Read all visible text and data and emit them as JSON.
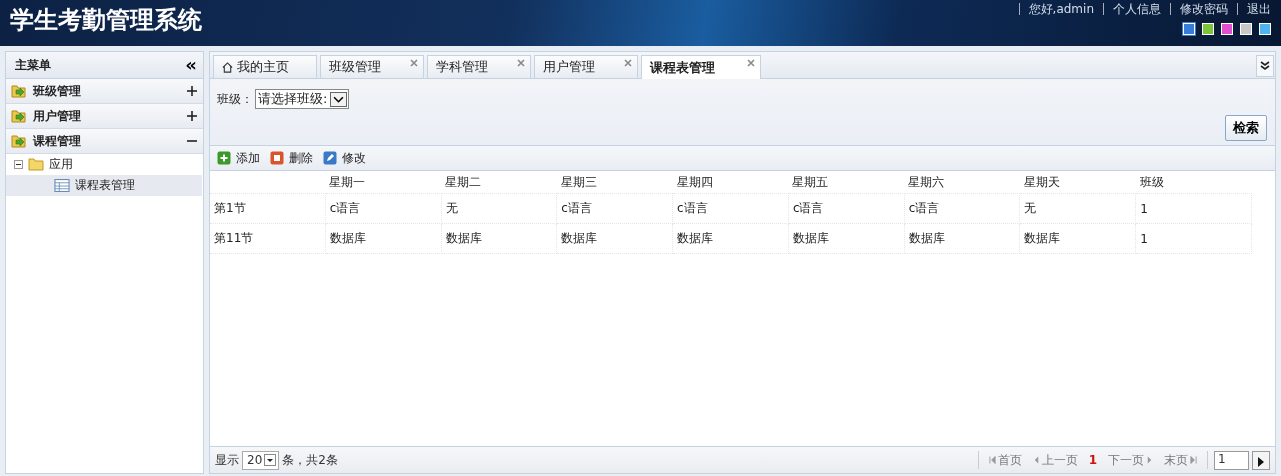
{
  "header": {
    "title": "学生考勤管理系统",
    "links": [
      "您好,admin",
      "个人信息",
      "修改密码",
      "退出"
    ],
    "themes": [
      {
        "color": "#3a7bd5",
        "selected": true
      },
      {
        "color": "#7cc43a",
        "selected": false
      },
      {
        "color": "#e04fcf",
        "selected": false
      },
      {
        "color": "#c8c8c8",
        "selected": false
      },
      {
        "color": "#4fb3f0",
        "selected": false
      }
    ]
  },
  "sidebar": {
    "title": "主菜单",
    "collapse": "«",
    "sections": [
      {
        "label": "班级管理",
        "expanded": false
      },
      {
        "label": "用户管理",
        "expanded": false
      },
      {
        "label": "课程管理",
        "expanded": true,
        "children": [
          {
            "label": "应用",
            "kind": "folder",
            "children": [
              {
                "label": "课程表管理",
                "kind": "page",
                "selected": true
              }
            ]
          }
        ]
      }
    ]
  },
  "tabs": [
    {
      "label": "我的主页",
      "selected": false,
      "closable": false,
      "kind": "home"
    },
    {
      "label": "班级管理",
      "selected": false,
      "closable": true
    },
    {
      "label": "学科管理",
      "selected": false,
      "closable": true
    },
    {
      "label": "用户管理",
      "selected": false,
      "closable": true
    },
    {
      "label": "课程表管理",
      "selected": true,
      "closable": true
    }
  ],
  "filter": {
    "label": "班级：",
    "value": "请选择班级:",
    "button": "检索"
  },
  "toolbar": [
    {
      "label": "添加",
      "kind": "add"
    },
    {
      "label": "删除",
      "kind": "delete"
    },
    {
      "label": "修改",
      "kind": "edit"
    }
  ],
  "table": {
    "columns": [
      "",
      "星期一",
      "星期二",
      "星期三",
      "星期四",
      "星期五",
      "星期六",
      "星期天",
      "班级"
    ],
    "rows": [
      [
        "第1节",
        "c语言",
        "无",
        "c语言",
        "c语言",
        "c语言",
        "c语言",
        "无",
        "1"
      ],
      [
        "第11节",
        "数据库",
        "数据库",
        "数据库",
        "数据库",
        "数据库",
        "数据库",
        "数据库",
        "1"
      ]
    ]
  },
  "pager": {
    "show": "显示",
    "size": "20",
    "summary": "条，共2条",
    "first": "首页",
    "prev": "上一页",
    "current": "1",
    "next": "下一页",
    "last": "末页",
    "page": "1"
  }
}
